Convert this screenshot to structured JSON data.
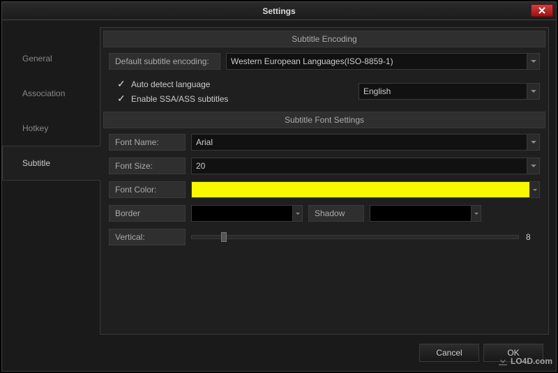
{
  "window": {
    "title": "Settings"
  },
  "sidebar": {
    "items": [
      {
        "label": "General"
      },
      {
        "label": "Association"
      },
      {
        "label": "Hotkey"
      },
      {
        "label": "Subtitle"
      }
    ],
    "active_index": 3
  },
  "encoding": {
    "header": "Subtitle Encoding",
    "default_label": "Default subtitle encoding:",
    "default_value": "Western European Languages(ISO-8859-1)",
    "auto_detect_label": "Auto detect language",
    "auto_detect_checked": true,
    "enable_ssa_label": "Enable SSA/ASS subtitles",
    "enable_ssa_checked": true,
    "language_value": "English"
  },
  "font": {
    "header": "Subtitle Font Settings",
    "name_label": "Font Name:",
    "name_value": "Arial",
    "size_label": "Font Size:",
    "size_value": "20",
    "color_label": "Font Color:",
    "color_value": "#f8f800",
    "border_label": "Border",
    "border_value": "#000000",
    "shadow_label": "Shadow",
    "shadow_value": "#000000",
    "vertical_label": "Vertical:",
    "vertical_value": "8"
  },
  "buttons": {
    "cancel": "Cancel",
    "ok": "OK"
  },
  "watermark": "LO4D.com"
}
